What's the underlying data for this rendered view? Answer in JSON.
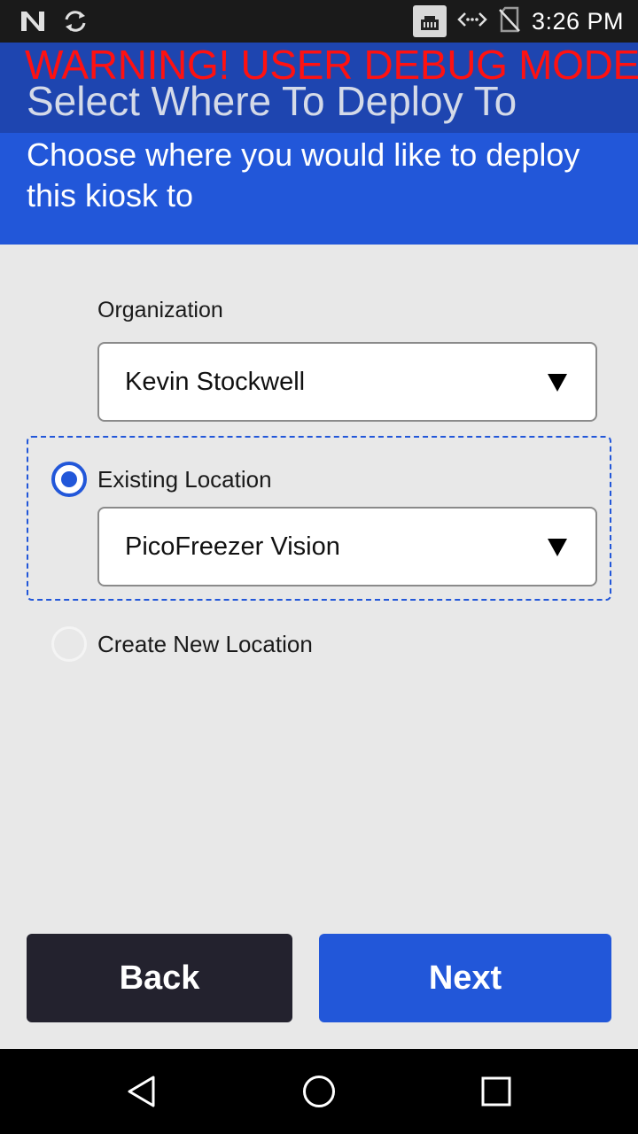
{
  "status_bar": {
    "time": "3:26 PM",
    "left_icons": [
      "n-logo-icon",
      "sync-icon"
    ],
    "right_icons": [
      "ethernet-icon",
      "data-transfer-icon",
      "no-sim-icon"
    ]
  },
  "header": {
    "debug_warning": "WARNING! USER DEBUG MODE",
    "title": "Select Where To Deploy To",
    "subtitle": "Choose where you would like to deploy this kiosk to"
  },
  "form": {
    "organization_label": "Organization",
    "organization_value": "Kevin Stockwell",
    "existing_location_label": "Existing Location",
    "existing_location_selected": true,
    "existing_location_value": "PicoFreezer Vision",
    "new_location_label": "Create New Location",
    "new_location_selected": false
  },
  "buttons": {
    "back_label": "Back",
    "next_label": "Next"
  },
  "colors": {
    "title_bar": "#1e45b0",
    "accent": "#2257d9",
    "warning": "#ff1111",
    "back_button": "#23222e"
  },
  "nav_bar": {
    "icons": [
      "nav-back-icon",
      "nav-home-icon",
      "nav-recents-icon"
    ]
  }
}
